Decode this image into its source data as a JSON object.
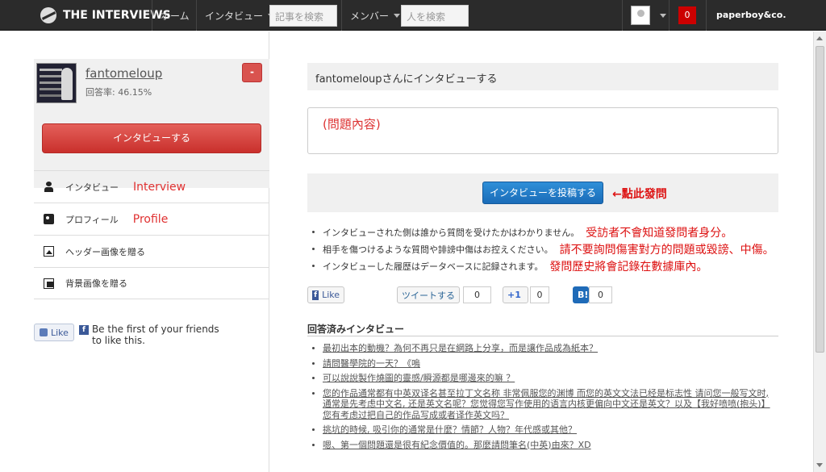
{
  "topbar": {
    "logo_text": "THE INTERVIEWS",
    "nav_home": "ホーム",
    "nav_interview": "インタビュー",
    "search_articles_placeholder": "記事を検索",
    "nav_members": "メンバー",
    "search_people_placeholder": "人を検索",
    "notif_count": "0",
    "brand": "paperboy&co."
  },
  "profile": {
    "username": "fantomeloup",
    "answer_rate": "回答率: 46.15%",
    "minus_label": "-",
    "interview_button": "インタビューする"
  },
  "menu": {
    "items": [
      {
        "label": "インタビュー",
        "annotation": "Interview",
        "icon": "person-icon"
      },
      {
        "label": "プロフィール",
        "annotation": "Profile",
        "icon": "profile-card-icon"
      },
      {
        "label": "ヘッダー画像を贈る",
        "annotation": "",
        "icon": "image-icon"
      },
      {
        "label": "背景画像を贈る",
        "annotation": "",
        "icon": "images-icon"
      }
    ]
  },
  "facebook_widget": {
    "like_label": "Like",
    "text": "Be the first of your friends to like this."
  },
  "main": {
    "title": "fantomeloupさんにインタビューする",
    "question_placeholder": "(問題內容)",
    "post_button": "インタビューを投稿する",
    "post_annotation": "←點此發問",
    "notes": [
      {
        "text": "インタビューされた側は誰から質問を受けたかはわかりません。",
        "annotation": "受訪者不會知道發問者身分。"
      },
      {
        "text": "相手を傷つけるような質問や誹謗中傷はお控えください。",
        "annotation": "請不要詢問傷害對方的問題或毀謗、中傷。"
      },
      {
        "text": "インタビューした履歴はデータベースに記録されます。",
        "annotation": "發問歷史將會記錄在數據庫內。"
      }
    ],
    "share": {
      "like": "Like",
      "tweet": "ツイートする",
      "tweet_count": "0",
      "plus_one": "+1",
      "plus_count": "0",
      "hatena": "B!",
      "hatena_count": "0"
    },
    "answered_heading": "回答済みインタビュー",
    "answered": [
      "最初出本的動機？為何不再只是在網路上分享，而是讓作品成為紙本？",
      "請問醫學院的一天？《嗚",
      "可以說說製作燒圖的靈感/瞬源都是哪邊來的嘛 ？",
      "您的作品通常都有中英双译名甚至拉丁文名称 非常佩服您的渊博 而您的英文文法已经是标志性 请问您一般写文时, 通常是先考虑中文名, 还是英文名呢？您觉得您写作使用的语言内核更偏向中文还是英文？以及【我好喷喷(抱头)】您有考虑过把自己的作品写成或者译作英文吗？",
      "挑坑的時候, 吸引你的通常是什麼？情節？人物？年代感或其他？",
      "嗯、第一個問題還是很有紀念價值的。那麼請問筆名(中英)由來？XD"
    ]
  },
  "colors": {
    "topbar": "#2b2b2b",
    "red_button": "#d9534f",
    "blue_button": "#1a6cb8",
    "annotation_red": "#dd1111"
  }
}
